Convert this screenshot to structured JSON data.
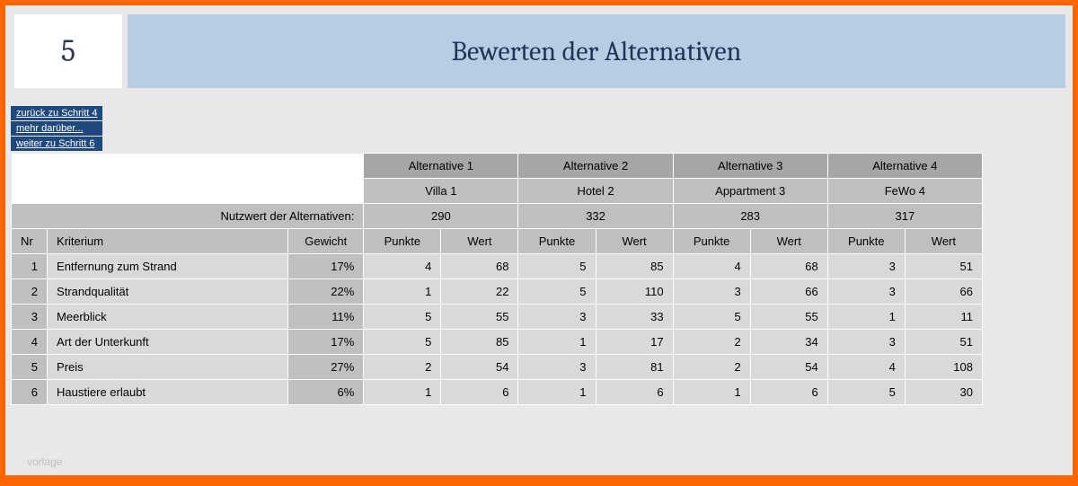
{
  "header": {
    "step": "5",
    "title": "Bewerten der Alternativen"
  },
  "nav": {
    "back": "zurück zu Schritt 4",
    "more": "mehr darüber...",
    "next": "weiter zu Schritt 6"
  },
  "labels": {
    "nutzwert": "Nutzwert der Alternativen:",
    "nr": "Nr",
    "kriterium": "Kriterium",
    "gewicht": "Gewicht",
    "punkte": "Punkte",
    "wert": "Wert"
  },
  "alternatives": [
    {
      "header": "Alternative 1",
      "name": "Villa 1",
      "nutzwert": "290"
    },
    {
      "header": "Alternative 2",
      "name": "Hotel 2",
      "nutzwert": "332"
    },
    {
      "header": "Alternative 3",
      "name": "Appartment 3",
      "nutzwert": "283"
    },
    {
      "header": "Alternative 4",
      "name": "FeWo 4",
      "nutzwert": "317"
    }
  ],
  "criteria": [
    {
      "nr": "1",
      "name": "Entfernung zum Strand",
      "gewicht": "17%",
      "scores": [
        {
          "p": "4",
          "w": "68"
        },
        {
          "p": "5",
          "w": "85"
        },
        {
          "p": "4",
          "w": "68"
        },
        {
          "p": "3",
          "w": "51"
        }
      ]
    },
    {
      "nr": "2",
      "name": "Strandqualität",
      "gewicht": "22%",
      "scores": [
        {
          "p": "1",
          "w": "22"
        },
        {
          "p": "5",
          "w": "110"
        },
        {
          "p": "3",
          "w": "66"
        },
        {
          "p": "3",
          "w": "66"
        }
      ]
    },
    {
      "nr": "3",
      "name": "Meerblick",
      "gewicht": "11%",
      "scores": [
        {
          "p": "5",
          "w": "55"
        },
        {
          "p": "3",
          "w": "33"
        },
        {
          "p": "5",
          "w": "55"
        },
        {
          "p": "1",
          "w": "11"
        }
      ]
    },
    {
      "nr": "4",
      "name": "Art der Unterkunft",
      "gewicht": "17%",
      "scores": [
        {
          "p": "5",
          "w": "85"
        },
        {
          "p": "1",
          "w": "17"
        },
        {
          "p": "2",
          "w": "34"
        },
        {
          "p": "3",
          "w": "51"
        }
      ]
    },
    {
      "nr": "5",
      "name": "Preis",
      "gewicht": "27%",
      "scores": [
        {
          "p": "2",
          "w": "54"
        },
        {
          "p": "3",
          "w": "81"
        },
        {
          "p": "2",
          "w": "54"
        },
        {
          "p": "4",
          "w": "108"
        }
      ]
    },
    {
      "nr": "6",
      "name": "Haustiere erlaubt",
      "gewicht": "6%",
      "scores": [
        {
          "p": "1",
          "w": "6"
        },
        {
          "p": "1",
          "w": "6"
        },
        {
          "p": "1",
          "w": "6"
        },
        {
          "p": "5",
          "w": "30"
        }
      ]
    }
  ],
  "watermark": "vorlage"
}
